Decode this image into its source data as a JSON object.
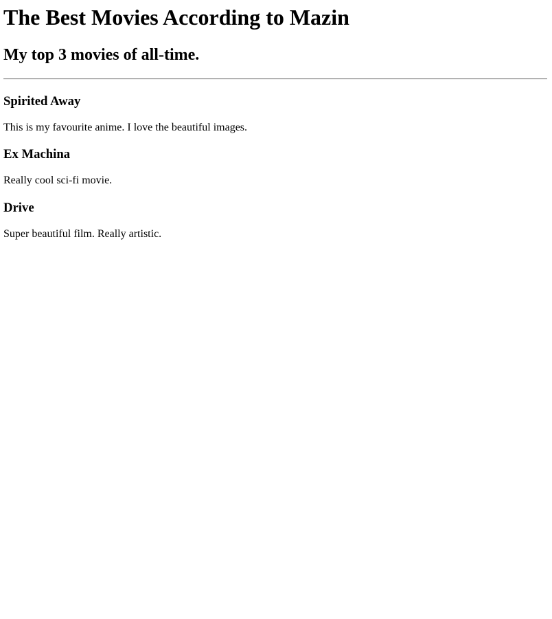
{
  "page": {
    "title": "The Best Movies According to Mazin",
    "subtitle": "My top 3 movies of all-time."
  },
  "movies": [
    {
      "title": "Spirited Away",
      "description": "This is my favourite anime. I love the beautiful images."
    },
    {
      "title": "Ex Machina",
      "description": "Really cool sci-fi movie."
    },
    {
      "title": "Drive",
      "description": "Super beautiful film. Really artistic."
    }
  ]
}
